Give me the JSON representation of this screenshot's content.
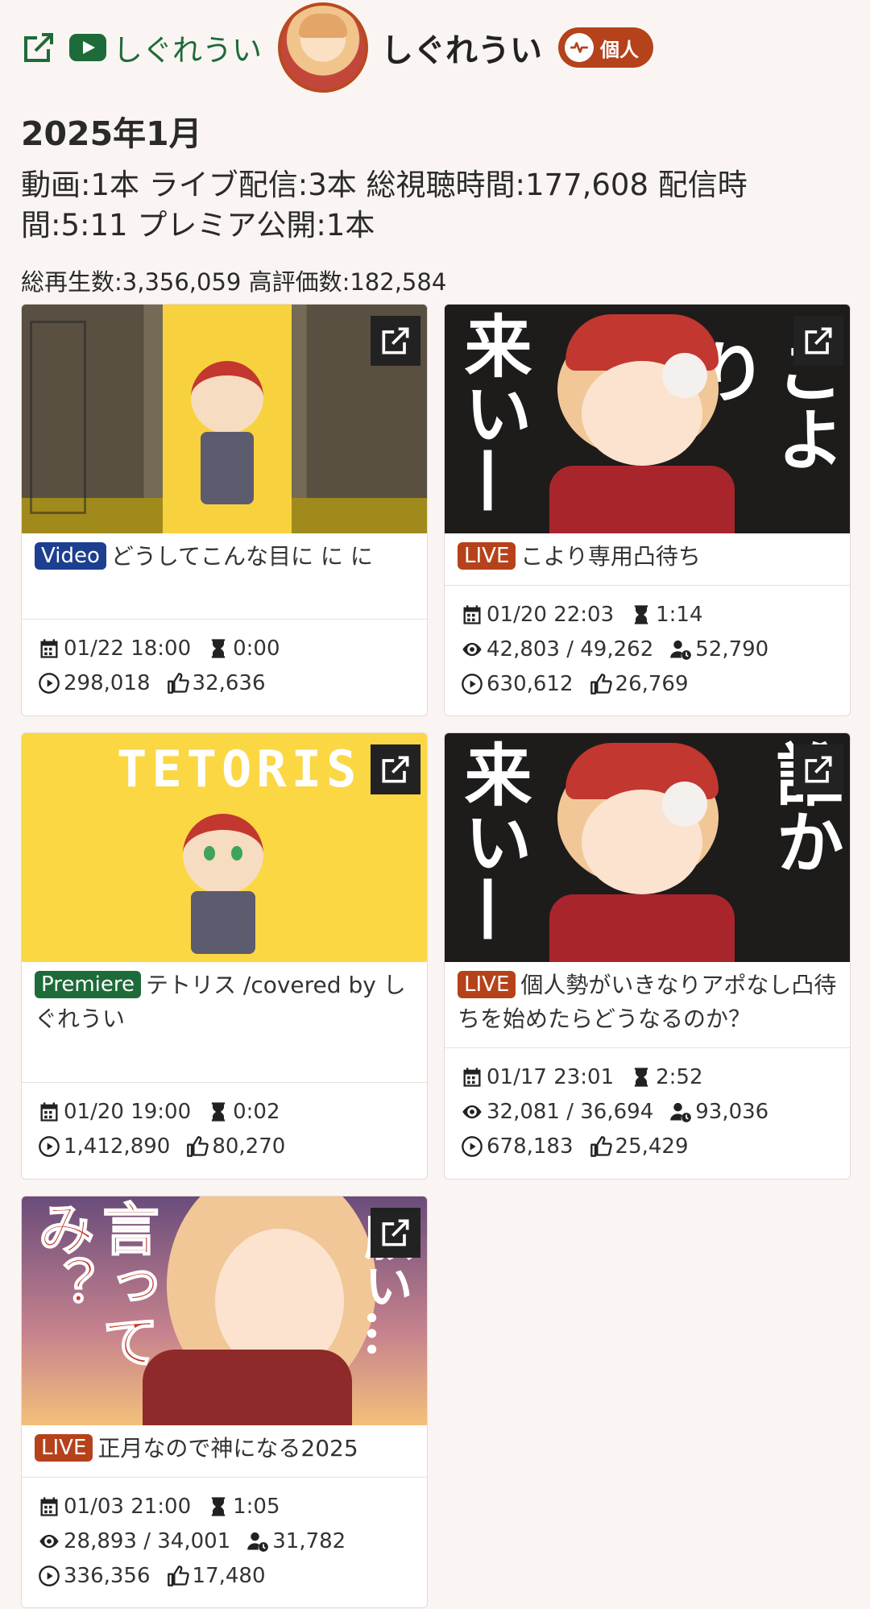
{
  "header": {
    "channel_link_text": "しぐれうい",
    "channel_name": "しぐれうい",
    "badge": "個人"
  },
  "month": "2025年1月",
  "summary": "動画:1本 ライブ配信:3本 総視聴時間:177,608 配信時間:5:11 プレミア公開:1本",
  "totals": "総再生数:3,356,059 高評価数:182,584",
  "colors": {
    "accent_green": "#1d6b39",
    "live": "#b5421b",
    "video": "#1d3f8f",
    "premiere": "#1d6b39"
  },
  "icons": [
    "external-link-icon",
    "youtube-icon",
    "pulse-icon",
    "calendar-icon",
    "hourglass-icon",
    "eye-icon",
    "concurrent-viewers-icon",
    "play-icon",
    "thumbs-up-icon"
  ],
  "cards": [
    {
      "type": "Video",
      "title": "どうしてこんな目に に に",
      "date": "01/22 18:00",
      "duration": "0:00",
      "plays": "298,018",
      "likes": "32,636"
    },
    {
      "type": "LIVE",
      "title": "こより専用凸待ち",
      "thumb_text": [
        "来い—",
        "こより"
      ],
      "date": "01/20 22:03",
      "duration": "1:14",
      "viewers": "42,803 / 49,262",
      "concurrent": "52,790",
      "plays": "630,612",
      "likes": "26,769"
    },
    {
      "type": "Premiere",
      "title": "テトリス /covered by しぐれうい",
      "thumb_text": [
        "TETORIS"
      ],
      "date": "01/20 19:00",
      "duration": "0:02",
      "plays": "1,412,890",
      "likes": "80,270"
    },
    {
      "type": "LIVE",
      "title": "個人勢がいきなりアポなし凸待ちを始めたらどうなるのか？",
      "thumb_text": [
        "来い—",
        "誰か"
      ],
      "date": "01/17 23:01",
      "duration": "2:52",
      "viewers": "32,081 / 36,694",
      "concurrent": "93,036",
      "plays": "678,183",
      "likes": "25,429"
    },
    {
      "type": "LIVE",
      "title": "正月なので神になる2025",
      "thumb_text": [
        "言ってみ？",
        "願い…"
      ],
      "date": "01/03 21:00",
      "duration": "1:05",
      "viewers": "28,893 / 34,001",
      "concurrent": "31,782",
      "plays": "336,356",
      "likes": "17,480"
    }
  ]
}
